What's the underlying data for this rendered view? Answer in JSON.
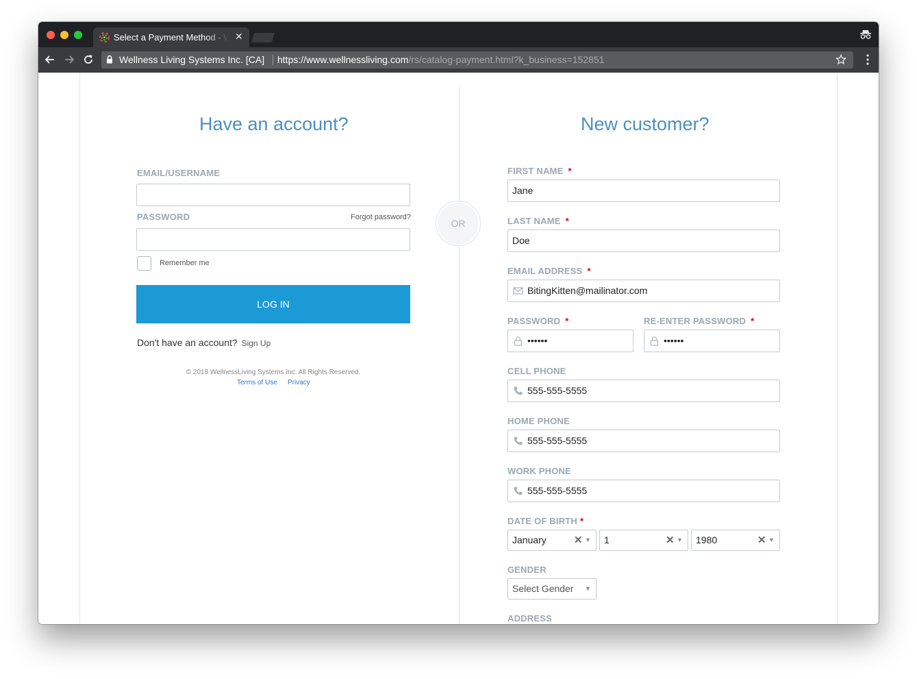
{
  "browser": {
    "tab_title": "Select a Payment Method - Wellness Living",
    "tab_close": "✕",
    "site_name": "Wellness Living Systems Inc. [CA]",
    "url_main": "https://www.wellnessliving.com",
    "url_rest": "/rs/catalog-payment.html?k_business=152851"
  },
  "login": {
    "heading": "Have an account?",
    "email_label": "EMAIL/USERNAME",
    "email_value": "",
    "password_label": "PASSWORD",
    "password_value": "",
    "forgot_label": "Forgot password?",
    "remember_label": "Remember me",
    "login_button": "LOG IN",
    "no_account_text": "Don't have an account?",
    "signup_link": "Sign Up",
    "copyright": "© 2018 WellnessLiving Systems Inc. All Rights Reserved.",
    "terms_link": "Terms of Use",
    "privacy_link": "Privacy"
  },
  "divider": {
    "or_label": "OR"
  },
  "register": {
    "heading": "New customer?",
    "required_mark": "*",
    "first_name_label": "FIRST NAME",
    "first_name_value": "Jane",
    "last_name_label": "LAST NAME",
    "last_name_value": "Doe",
    "email_label": "EMAIL ADDRESS",
    "email_value": "BitingKitten@mailinator.com",
    "password_label": "PASSWORD",
    "password_value": "••••••",
    "reenter_label": "RE-ENTER PASSWORD",
    "reenter_value": "••••••",
    "cell_label": "CELL PHONE",
    "cell_value": "555-555-5555",
    "home_label": "HOME PHONE",
    "home_value": "555-555-5555",
    "work_label": "WORK PHONE",
    "work_value": "555-555-5555",
    "dob_label": "DATE OF BIRTH",
    "dob_month": "January",
    "dob_day": "1",
    "dob_year": "1980",
    "clear_glyph": "✕",
    "arrow_glyph": "▼",
    "gender_label": "GENDER",
    "gender_placeholder": "Select Gender",
    "address_label": "ADDRESS"
  },
  "icons": [
    "lock-icon",
    "star-icon",
    "incognito-icon",
    "back-arrow-icon",
    "forward-arrow-icon",
    "reload-icon",
    "mail-icon",
    "phone-icon",
    "password-lock-icon"
  ],
  "colors": {
    "accent": "#1c9ad6",
    "heading": "#4a90c2",
    "label": "#9ca8b1",
    "required": "#d0021b"
  }
}
